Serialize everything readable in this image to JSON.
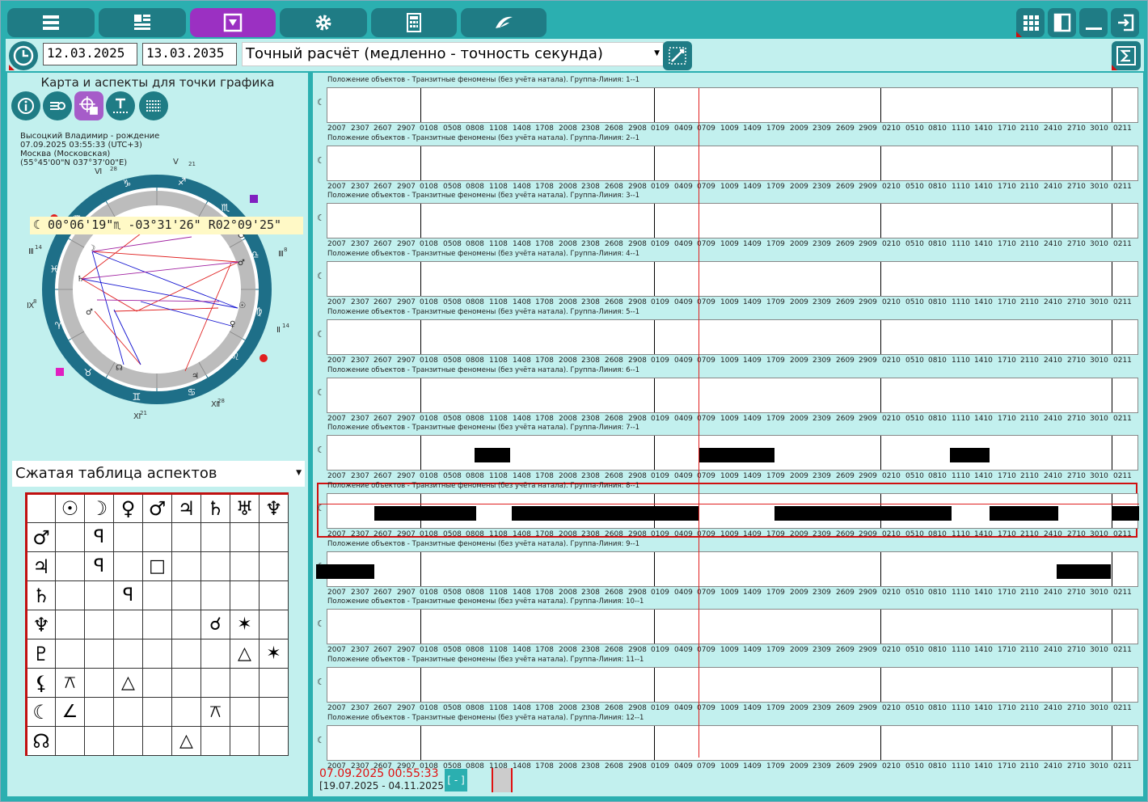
{
  "toolbar": {
    "left_icons": [
      "menu-icon",
      "layout-list-icon",
      "download-box-icon",
      "gear-icon",
      "calculator-icon",
      "logo-icon"
    ],
    "right_icons": [
      "grid-icon",
      "panel-toggle-icon",
      "minimize-icon",
      "exit-icon"
    ]
  },
  "row2": {
    "date_from": "12.03.2025",
    "date_to": "13.03.2035",
    "calc_mode": "Точный расчёт (медленно - точность секунда)"
  },
  "left": {
    "title": "Карта и аспекты для точки графика",
    "info_lines": [
      "Высоцкий Владимир - рождение",
      "07.09.2025 03:55:33 (UTC+3)",
      "Москва (Московская)",
      "(55°45'00\"N 037°37'00\"E)"
    ],
    "readout": "☾ 00°06'19\"♏ -03°31'26\" R02°09'25\"",
    "aspect_select": "Сжатая таблица аспектов",
    "aspect_headers": [
      "☉",
      "☽",
      "♀",
      "♂",
      "♃",
      "♄",
      "♅",
      "♆"
    ],
    "aspect_rows": [
      {
        "glyph": "♂",
        "cells": [
          "",
          "ꟼ",
          "",
          "",
          "",
          "",
          "",
          ""
        ]
      },
      {
        "glyph": "♃",
        "cells": [
          "",
          "ꟼ",
          "",
          "□",
          "",
          "",
          "",
          ""
        ]
      },
      {
        "glyph": "♄",
        "cells": [
          "",
          "",
          "ꟼ",
          "",
          "",
          "",
          "",
          ""
        ]
      },
      {
        "glyph": "♆",
        "cells": [
          "",
          "",
          "",
          "",
          "",
          "☌",
          "✶",
          ""
        ]
      },
      {
        "glyph": "♇",
        "cells": [
          "",
          "",
          "",
          "",
          "",
          "",
          "△",
          "✶"
        ]
      },
      {
        "glyph": "⚸",
        "cells": [
          "⚻",
          "",
          "△",
          "",
          "",
          "",
          "",
          ""
        ]
      },
      {
        "glyph": "☾",
        "cells": [
          "∠",
          "",
          "",
          "",
          "",
          "⚻",
          "",
          ""
        ]
      },
      {
        "glyph": "☊",
        "cells": [
          "",
          "",
          "",
          "",
          "△",
          "",
          "",
          ""
        ]
      }
    ]
  },
  "right": {
    "row_label_prefix": "Положение объектов - Транзитные феномены (без учёта натала). Группа-Линия: ",
    "rows": [
      {
        "line": "1--1",
        "bars": []
      },
      {
        "line": "2--1",
        "bars": []
      },
      {
        "line": "3--1",
        "bars": []
      },
      {
        "line": "4--1",
        "bars": []
      },
      {
        "line": "5--1",
        "bars": []
      },
      {
        "line": "6--1",
        "bars": []
      },
      {
        "line": "7--1",
        "bars": [
          [
            0.181,
            0.044
          ],
          [
            0.458,
            0.093
          ],
          [
            0.767,
            0.049
          ]
        ]
      },
      {
        "line": "8--1",
        "bars": [
          [
            0.058,
            0.125
          ],
          [
            0.227,
            0.231
          ],
          [
            0.551,
            0.218
          ],
          [
            0.816,
            0.085
          ],
          [
            0.966,
            0.034
          ]
        ]
      },
      {
        "line": "9--1",
        "bars": [
          [
            -0.014,
            0.072
          ],
          [
            0.898,
            0.067
          ]
        ]
      },
      {
        "line": "10--1",
        "bars": []
      },
      {
        "line": "11--1",
        "bars": []
      },
      {
        "line": "12--1",
        "bars": []
      }
    ],
    "ticks": [
      "2007",
      "2307",
      "2607",
      "2907",
      "0108",
      "0508",
      "0808",
      "1108",
      "1408",
      "1708",
      "2008",
      "2308",
      "2608",
      "2908",
      "0109",
      "0409",
      "0709",
      "1009",
      "1409",
      "1709",
      "2009",
      "2309",
      "2609",
      "2909",
      "0210",
      "0510",
      "0810",
      "1110",
      "1410",
      "1710",
      "2110",
      "2410",
      "2710",
      "3010",
      "0211"
    ],
    "bottom_date": "07.09.2025 00:55:33",
    "bottom_range": "[19.07.2025 - 04.11.2025]",
    "minus_label": "[ - ]"
  },
  "colors": {
    "frame": "#2bafb0",
    "panel": "#c2f0ee",
    "button": "#1f7c85",
    "active": "#9b30c2",
    "cursor": "#e02020"
  }
}
